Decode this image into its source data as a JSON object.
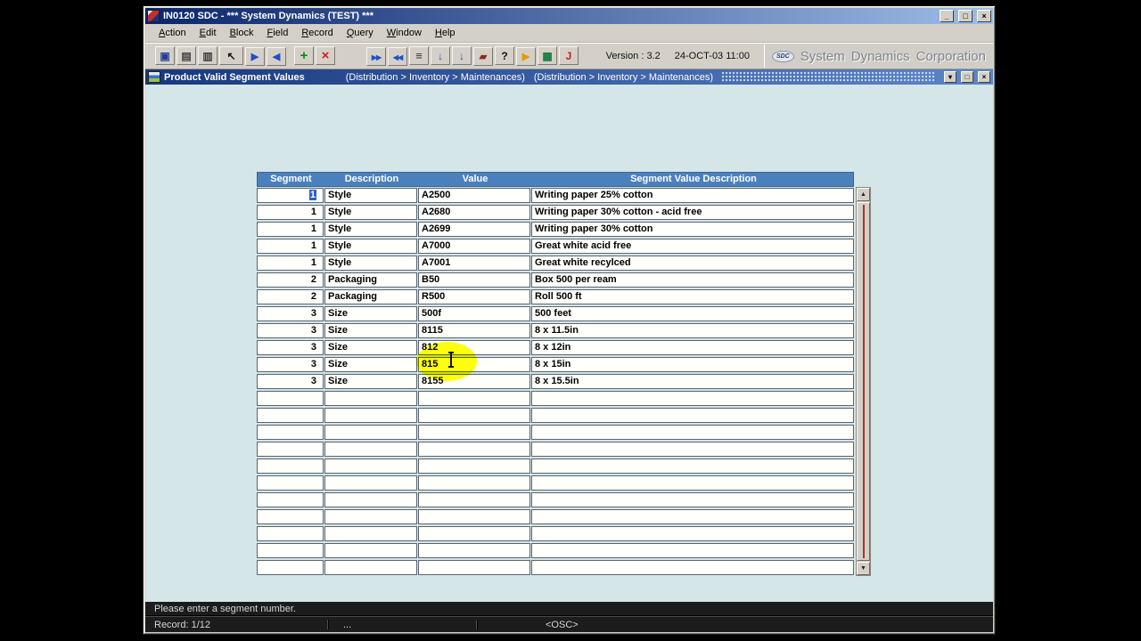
{
  "window": {
    "title": "IN0120 SDC - ***  System Dynamics (TEST)  ***"
  },
  "menu": {
    "items": [
      "Action",
      "Edit",
      "Block",
      "Field",
      "Record",
      "Query",
      "Window",
      "Help"
    ]
  },
  "toolbar": {
    "icons": [
      "save-icon",
      "print-icon",
      "print-setup-icon",
      "clear-form-icon",
      "next-record-icon",
      "previous-record-icon",
      "insert-record-icon",
      "delete-record-icon",
      "next-block-icon",
      "previous-block-icon",
      "list-values-icon",
      "export-icon",
      "import-icon",
      "clear-record-icon",
      "help-icon",
      "execute-query-icon",
      "calculator-icon",
      "exit-icon"
    ],
    "version_label": "Version : 3.2",
    "datetime": "24-OCT-03 11:00",
    "logo": {
      "mark": "SDC",
      "words": [
        "System",
        "Dynamics",
        "Corporation"
      ]
    }
  },
  "mdi": {
    "title": "Product Valid Segment Values",
    "breadcrumb_1": "(Distribution > Inventory > Maintenances)",
    "breadcrumb_2": "(Distribution > Inventory > Maintenances)"
  },
  "table": {
    "headers": [
      "Segment",
      "Description",
      "Value",
      "Segment Value Description"
    ],
    "rows": [
      {
        "segment": "1",
        "description": "Style",
        "value": "A2500",
        "value_description": "Writing paper 25% cotton"
      },
      {
        "segment": "1",
        "description": "Style",
        "value": "A2680",
        "value_description": "Writing paper 30% cotton - acid free"
      },
      {
        "segment": "1",
        "description": "Style",
        "value": "A2699",
        "value_description": "Writing paper 30% cotton"
      },
      {
        "segment": "1",
        "description": "Style",
        "value": "A7000",
        "value_description": "Great white acid free"
      },
      {
        "segment": "1",
        "description": "Style",
        "value": "A7001",
        "value_description": "Great white recylced"
      },
      {
        "segment": "2",
        "description": "Packaging",
        "value": "B50",
        "value_description": "Box 500 per ream"
      },
      {
        "segment": "2",
        "description": "Packaging",
        "value": "R500",
        "value_description": "Roll 500 ft"
      },
      {
        "segment": "3",
        "description": "Size",
        "value": "500f",
        "value_description": "500 feet"
      },
      {
        "segment": "3",
        "description": "Size",
        "value": "8115",
        "value_description": "8 x 11.5in"
      },
      {
        "segment": "3",
        "description": "Size",
        "value": "812",
        "value_description": "8 x 12in"
      },
      {
        "segment": "3",
        "description": "Size",
        "value": "815",
        "value_description": "8 x 15in"
      },
      {
        "segment": "3",
        "description": "Size",
        "value": "8155",
        "value_description": "8 x 15.5in"
      }
    ],
    "empty_row_count": 11,
    "selection": {
      "row_index": 0,
      "column": "segment"
    }
  },
  "status": {
    "message": "Please enter a segment number.",
    "record": "Record: 1/12",
    "separator_text": "...",
    "osc": "<OSC>"
  },
  "colors": {
    "titlebar_start": "#0a246a",
    "titlebar_end": "#9dbde8",
    "mdi_start": "#17387e",
    "mdi_end": "#5d85c8",
    "header_blue": "#4b80bd",
    "content_teal": "#d5e6e8",
    "highlight_yellow": "#ffff00"
  }
}
